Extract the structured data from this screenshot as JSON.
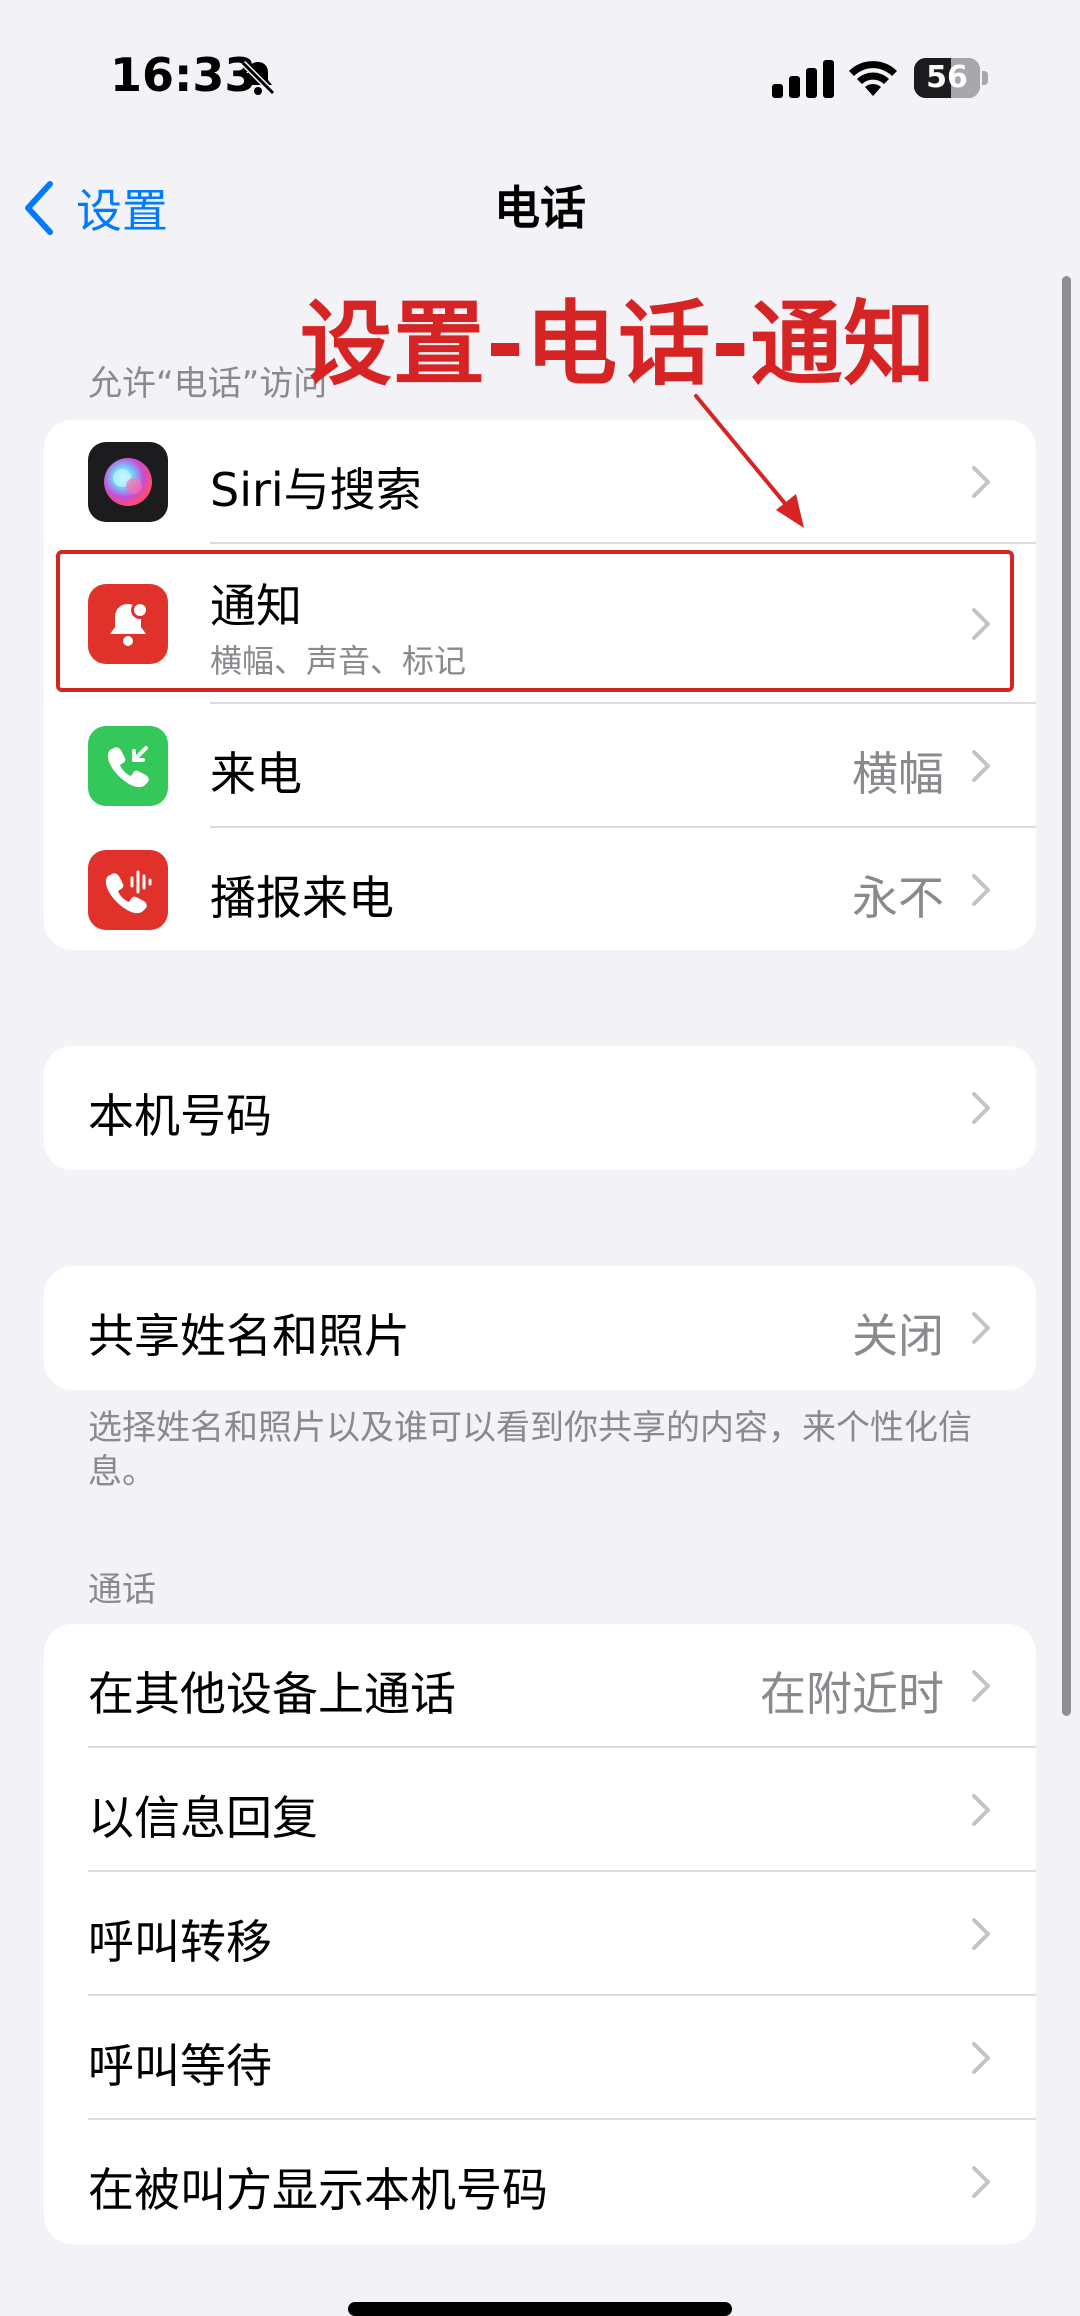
{
  "status_bar": {
    "time": "16:33",
    "battery_level": "56",
    "battery_fraction": 0.56,
    "icons": [
      "bell-slash-icon",
      "cellular-signal-icon",
      "wifi-icon",
      "battery-icon"
    ]
  },
  "nav": {
    "back_label": "设置",
    "title": "电话",
    "back_icon": "chevron-left-icon"
  },
  "annotation": {
    "text": "设置-电话-通知",
    "color": "#d62323",
    "arrow_icon": "arrow-down-right-icon"
  },
  "access_section": {
    "header": "允许“电话”访问",
    "rows": [
      {
        "label": "Siri与搜索",
        "icon": "siri-icon",
        "icon_bg": "#1c1c1e"
      },
      {
        "label": "通知",
        "subtitle": "横幅、声音、标记",
        "icon": "bell-badge-icon",
        "icon_bg": "#e0322a"
      },
      {
        "label": "来电",
        "value": "横幅",
        "icon": "incoming-call-icon",
        "icon_bg": "#34c759"
      },
      {
        "label": "播报来电",
        "value": "永不",
        "icon": "announce-call-icon",
        "icon_bg": "#e0322a"
      }
    ]
  },
  "my_number": {
    "label": "本机号码"
  },
  "share_name": {
    "label": "共享姓名和照片",
    "value": "关闭",
    "footer": "选择姓名和照片以及谁可以看到你共享的内容，来个性化信息。"
  },
  "calls_section": {
    "header": "通话",
    "rows": [
      {
        "label": "在其他设备上通话",
        "value": "在附近时"
      },
      {
        "label": "以信息回复"
      },
      {
        "label": "呼叫转移"
      },
      {
        "label": "呼叫等待"
      },
      {
        "label": "在被叫方显示本机号码"
      }
    ]
  },
  "colors": {
    "accent": "#007aff",
    "background": "#f2f2f7",
    "secondary_text": "#8a8a8e",
    "highlight_box": "#d62323"
  }
}
